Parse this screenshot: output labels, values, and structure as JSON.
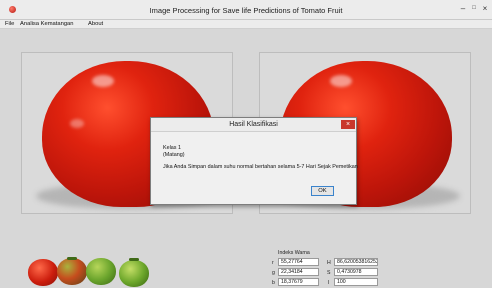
{
  "window": {
    "title": "Image Processing for Save life Predictions of Tomato Fruit",
    "minimize": "–",
    "maximize": "□",
    "close": "×"
  },
  "menu": [
    "File",
    "Analisa Kematangan",
    "About"
  ],
  "dialog": {
    "title": "Hasil Klasifikasi",
    "close": "×",
    "line1": "Kelas 1",
    "line2": "(Matang)",
    "line3": "Jika Anda Simpan dalam suhu normal bertahan selama 5-7 Hari Sejak Pemetikan",
    "ok": "OK"
  },
  "color_index": {
    "label": "Indeks Warna",
    "r_label": "r",
    "r_value": "55,27764",
    "g_label": "g",
    "g_value": "22,34184",
    "b_label": "b",
    "b_value": "18,37679",
    "h_label": "H",
    "h_value": "86,62005381625216",
    "s_label": "S",
    "s_value": "0,4730978",
    "i_label": "I",
    "i_value": "100"
  },
  "colors": {
    "tomato_red": "#c4170a",
    "dialog_close": "#c9382c",
    "ok_border": "#3a83cc"
  },
  "icons": [
    "app-icon",
    "tomato-image",
    "close-icon"
  ]
}
